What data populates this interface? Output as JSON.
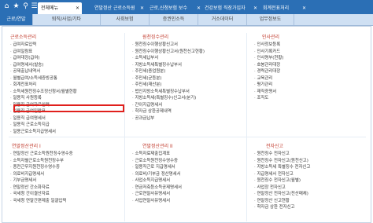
{
  "topbar": {
    "icons": [
      "home-icon",
      "star-icon",
      "search-icon",
      "menu-icon"
    ],
    "tabs": [
      {
        "label": "전체메뉴",
        "active": true
      },
      {
        "label": "연말정산 근로소득원",
        "active": false
      },
      {
        "label": "근로,신청보험 보수",
        "active": false
      },
      {
        "label": "건강보험 직장가입자",
        "active": false
      },
      {
        "label": "회계전표처리",
        "active": false
      }
    ]
  },
  "menubar": {
    "tabs": [
      "근로/연말",
      "퇴직/사업/기타",
      "사회보험",
      "증권인소득",
      "거소데이터",
      "업무정보도"
    ]
  },
  "sections": {
    "labor": {
      "title": "근로소득관리",
      "items": [
        "급여자료입력",
        "급여일람표",
        "급여대장(급여)",
        "급여명세서(발송)",
        "공제출납내역서",
        "월별급여/소득세증빙공통",
        "회계전표처리",
        "소득세원천징수조정신청서/월별현황",
        "일용직 사원등록",
        "일용직 급여자료입력",
        "일용직 급여일람표",
        "일용직 급여명세서",
        "일용직 근로소득지급",
        "일용근로소득지급명세서"
      ]
    },
    "withholding": {
      "title": "원천징수관리",
      "items": [
        "원천징수이행상황신고서",
        "원천징수이행상황신고서(원천신고현황)",
        "소득세납부서",
        "지방소득세특별징수납부서",
        "주민세(종업원분)",
        "주민세(균등분)",
        "주민세(재산분)",
        "법인지방소득세특별징수납부서",
        "지방소득세(특별징수)신고서(분기)",
        "간이지급명세서",
        "학자금 상환공제내역",
        "공과금납부"
      ]
    },
    "hr": {
      "title": "인사관리",
      "items": [
        "인사정보등록",
        "인사기록카드",
        "인사명부(현황)",
        "호봉관리대장",
        "경력관리대장",
        "교육관리",
        "평가관리",
        "재직증명서",
        "조직도"
      ]
    },
    "yearend": {
      "title": "연말정산관리 I",
      "items": [
        "연말정산 근로소득원천징수영수증",
        "소득자별근로소득원천징수부",
        "종전근무지원천징수영수증",
        "의료비지급명세서",
        "기부금명세서",
        "연말정산 간소화자료",
        "국세청 간이결산자료",
        "국세청 연말간편제출 일괄입력"
      ]
    },
    "yearend2": {
      "title": "연말정산관리 II",
      "items": [
        "소득자료제출집계표",
        "근로소득원천징수영수증",
        "일용직근로 지급명세서",
        "의료비/기부금 정산명세서",
        "사업소득지급명세서",
        "연금저축등소득공제명세서",
        "근로연말사유명세서",
        "사업연말사유명세서"
      ]
    },
    "efile": {
      "title": "전자신고",
      "items": [
        "원천징수 전자신고",
        "원천징수 전자신고(원천신고)",
        "지방소득세 특별징수 전자신고",
        "지급명세서 전자신고",
        "원천징수 전자신고(월별)",
        "사업장 전자신고",
        "연말정산 전자신고(전산매체)",
        "연말정산 신고현황",
        "학자금 상환 전자신고"
      ]
    }
  }
}
